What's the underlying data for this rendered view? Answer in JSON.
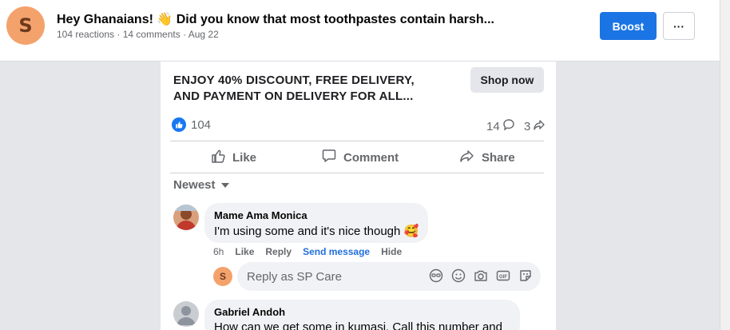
{
  "header": {
    "avatar_letter": "S",
    "title": "Hey Ghanaians! 👋 Did you know that most toothpastes contain harsh...",
    "meta": "104 reactions · 14 comments · Aug 22",
    "boost_label": "Boost",
    "more_label": "···"
  },
  "ad": {
    "line1": "ENJOY 40% DISCOUNT, FREE DELIVERY,",
    "line2": "AND PAYMENT ON DELIVERY FOR ALL...",
    "cta_label": "Shop now"
  },
  "stats": {
    "reactions": "104",
    "comments": "14",
    "shares": "3"
  },
  "actions": {
    "like": "Like",
    "comment": "Comment",
    "share": "Share"
  },
  "sort_label": "Newest",
  "comments": [
    {
      "name": "Mame Ama Monica",
      "text": "I'm using some and it's nice though 🥰",
      "time": "6h",
      "like": "Like",
      "reply": "Reply",
      "send_message": "Send message",
      "hide": "Hide"
    },
    {
      "name": "Gabriel Andoh",
      "text": "How can we get some in kumasi. Call this number and"
    }
  ],
  "reply_box": {
    "avatar_letter": "S",
    "placeholder": "Reply as SP Care"
  },
  "colors": {
    "brand_blue": "#1b74e4",
    "avatar_orange": "#f4a26c",
    "link_blue": "#216fdb"
  }
}
